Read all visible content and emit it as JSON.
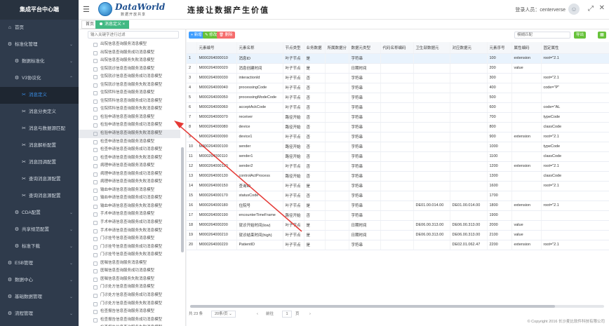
{
  "sidebar": {
    "title": "集成平台中心端",
    "items": [
      {
        "label": "首页",
        "icon": "home-icon",
        "glyph": "⌂",
        "level": 1,
        "chevron": ""
      },
      {
        "label": "标准化管理",
        "icon": "settings-icon",
        "glyph": "⚙",
        "level": 1,
        "chevron": "⌄"
      },
      {
        "label": "数据标准化",
        "icon": "settings-icon",
        "glyph": "⚙",
        "level": 2,
        "chevron": "⌄"
      },
      {
        "label": "V3协议化",
        "icon": "settings-icon",
        "glyph": "⚙",
        "level": 2,
        "chevron": "⌃"
      },
      {
        "label": "消息定义",
        "icon": "tool-icon",
        "glyph": "✂",
        "level": 3,
        "chevron": "",
        "active": true
      },
      {
        "label": "消息分类定义",
        "icon": "tool-icon",
        "glyph": "✂",
        "level": 3,
        "chevron": ""
      },
      {
        "label": "消息与数据源匹配",
        "icon": "tool-icon",
        "glyph": "✂",
        "level": 3,
        "chevron": ""
      },
      {
        "label": "消息解析配置",
        "icon": "tool-icon",
        "glyph": "✂",
        "level": 3,
        "chevron": ""
      },
      {
        "label": "消息回调配置",
        "icon": "tool-icon",
        "glyph": "✂",
        "level": 3,
        "chevron": ""
      },
      {
        "label": "查询消息源配置",
        "icon": "tool-icon",
        "glyph": "✂",
        "level": 3,
        "chevron": ""
      },
      {
        "label": "查询消息源配置",
        "icon": "tool-icon",
        "glyph": "✂",
        "level": 3,
        "chevron": ""
      },
      {
        "label": "CDA配置",
        "icon": "settings-icon",
        "glyph": "⚙",
        "level": 2,
        "chevron": "⌄"
      },
      {
        "label": "共享规范配置",
        "icon": "settings-icon",
        "glyph": "⚙",
        "level": 2,
        "chevron": "⌄"
      },
      {
        "label": "标准下载",
        "icon": "settings-icon",
        "glyph": "⚙",
        "level": 2,
        "chevron": "⌄"
      },
      {
        "label": "ESB管理",
        "icon": "settings-icon",
        "glyph": "⚙",
        "level": 1,
        "chevron": "⌄"
      },
      {
        "label": "数据中心",
        "icon": "settings-icon",
        "glyph": "⚙",
        "level": 1,
        "chevron": "⌄"
      },
      {
        "label": "基础数据管理",
        "icon": "settings-icon",
        "glyph": "⚙",
        "level": 1,
        "chevron": "⌄"
      },
      {
        "label": "流程管理",
        "icon": "settings-icon",
        "glyph": "⚙",
        "level": 1,
        "chevron": "⌄"
      },
      {
        "label": "统计管理",
        "icon": "settings-icon",
        "glyph": "⚙",
        "level": 1,
        "chevron": "⌄"
      }
    ]
  },
  "header": {
    "logo_text": "DataWorld",
    "logo_sub": "数据开放共享",
    "slogan": "连接让数据产生价值",
    "login_prefix": "登录人员：",
    "user": "centerverse"
  },
  "tabs": {
    "home": "首页",
    "current": "消息定义"
  },
  "tree": {
    "search_placeholder": "输入关键字进行过滤",
    "items": [
      "出院信息查询服务消息模型",
      "出院信息查询服务成功消息模型",
      "出院信息查询服务失败消息模型",
      "住院就诊信息查询服务消息模型",
      "住院就诊信息查询服务成功消息模型",
      "住院就诊信息查询服务失败消息模型",
      "住院转科信息查询服务消息模型",
      "住院转科信息查询服务成功消息模型",
      "住院转科信息查询服务失败消息模型",
      "检验申请信息查询服务消息模型",
      "检验申请信息查询服务成功消息模型",
      "检验申请信息查询服务失败消息模型",
      "检查申请信息查询服务消息模型",
      "检查申请信息查询服务成功消息模型",
      "检查申请信息查询服务失败消息模型",
      "病理申请信息查询服务消息模型",
      "病理申请信息查询服务成功消息模型",
      "病理申请信息查询服务失败消息模型",
      "输血申请信息查询服务消息模型",
      "输血申请信息查询服务成功消息模型",
      "输血申请信息查询服务失败消息模型",
      "手术申请信息查询服务消息模型",
      "手术申请信息查询服务成功消息模型",
      "手术申请信息查询服务失败消息模型",
      "门诊挂号信息查询服务消息模型",
      "门诊挂号信息查询服务成功消息模型",
      "门诊挂号信息查询服务失败消息模型",
      "医嘱信息查询服务消息模型",
      "医嘱信息查询服务成功消息模型",
      "医嘱信息查询服务失败消息模型",
      "门诊处方信息查询服务消息模型",
      "门诊处方信息查询服务成功消息模型",
      "门诊处方信息查询服务失败消息模型",
      "检查报告信息查询服务消息模型",
      "检查报告信息查询服务成功消息模型",
      "检查报告信息查询服务失败消息模型"
    ],
    "selected_index": 11
  },
  "toolbar": {
    "add": "+ 新增",
    "edit": "✎ 修改",
    "delete": "🗑 删除",
    "search_placeholder": "模糊匹配",
    "export": "导出",
    "grid_glyph": "▦"
  },
  "table": {
    "headers": [
      "",
      "元素编号",
      "元素名称",
      "节点类型",
      "业务数据",
      "所属数据分",
      "数据元类型",
      "代码名称编码",
      "卫生部数据元",
      "对应数据元",
      "元素序号",
      "属性编码",
      "固定属性"
    ],
    "rows": [
      [
        "1",
        "M000264000010",
        "消息ID",
        "叶子节点",
        "是",
        "",
        "字符串",
        "",
        "",
        "",
        "100",
        "extension",
        "root=\"2.1"
      ],
      [
        "2",
        "M000264000020",
        "消息创建时间",
        "叶子节点",
        "是",
        "",
        "日期时间",
        "",
        "",
        "",
        "200",
        "value",
        ""
      ],
      [
        "3",
        "M000264000030",
        "interactionId",
        "叶子节点",
        "否",
        "",
        "字符串",
        "",
        "",
        "",
        "300",
        "",
        "root=\"2.1"
      ],
      [
        "4",
        "M000264000040",
        "processingCode",
        "叶子节点",
        "否",
        "",
        "字符串",
        "",
        "",
        "",
        "400",
        "",
        "code=\"P\""
      ],
      [
        "5",
        "M000264000050",
        "processingModeCode",
        "叶子节点",
        "否",
        "",
        "字符串",
        "",
        "",
        "",
        "500",
        "",
        ""
      ],
      [
        "6",
        "M000264000060",
        "acceptAckCode",
        "叶子节点",
        "否",
        "",
        "字符串",
        "",
        "",
        "",
        "600",
        "",
        "code=\"AL"
      ],
      [
        "7",
        "M000264000070",
        "receiver",
        "路径开始",
        "否",
        "",
        "字符串",
        "",
        "",
        "",
        "700",
        "",
        "typeCode"
      ],
      [
        "8",
        "M000264000080",
        "device",
        "路径开始",
        "否",
        "",
        "字符串",
        "",
        "",
        "",
        "800",
        "",
        "classCode"
      ],
      [
        "9",
        "M000264000090",
        "device1",
        "叶子节点",
        "否",
        "",
        "字符串",
        "",
        "",
        "",
        "900",
        "extension",
        "root=\"2.1"
      ],
      [
        "10",
        "M000264000100",
        "sender",
        "路径开始",
        "否",
        "",
        "字符串",
        "",
        "",
        "",
        "1000",
        "",
        "typeCode"
      ],
      [
        "11",
        "M000264000110",
        "sender1",
        "路径开始",
        "否",
        "",
        "字符串",
        "",
        "",
        "",
        "1100",
        "",
        "classCode"
      ],
      [
        "12",
        "M000264000120",
        "sender2",
        "叶子节点",
        "否",
        "",
        "字符串",
        "",
        "",
        "",
        "1200",
        "extension",
        "root=\"2.1"
      ],
      [
        "13",
        "M000264000130",
        "controlActProcess",
        "路径开始",
        "否",
        "",
        "字符串",
        "",
        "",
        "",
        "1300",
        "",
        "classCode"
      ],
      [
        "14",
        "M000264000150",
        "查询ID",
        "叶子节点",
        "是",
        "",
        "字符串",
        "",
        "",
        "",
        "1600",
        "",
        "root=\"2.1"
      ],
      [
        "15",
        "M000264000170",
        "statusCode",
        "叶子节点",
        "否",
        "",
        "字符串",
        "",
        "",
        "",
        "1700",
        "",
        ""
      ],
      [
        "16",
        "M000264000180",
        "住院号",
        "叶子节点",
        "是",
        "",
        "字符串",
        "",
        "DE01.00.014.00",
        "DE01.00.014.00",
        "1800",
        "extension",
        "root=\"2.1"
      ],
      [
        "17",
        "M000264000190",
        "encounterTimeFrame",
        "路径开始",
        "否",
        "",
        "字符串",
        "",
        "",
        "",
        "1900",
        "",
        ""
      ],
      [
        "18",
        "M000264000200",
        "就诊开始时间(low)",
        "叶子节点",
        "是",
        "",
        "日期时间",
        "",
        "DE06.00.313.00",
        "DE06.00.313.00",
        "2000",
        "value",
        ""
      ],
      [
        "19",
        "M000264000210",
        "就诊结束时间(high)",
        "叶子节点",
        "是",
        "",
        "日期时间",
        "",
        "DE06.00.313.00",
        "DE06.00.313.00",
        "2100",
        "value",
        ""
      ],
      [
        "20",
        "M000264000220",
        "PatientID",
        "叶子节点",
        "是",
        "",
        "字符串",
        "",
        "",
        "DE02.01.062.47",
        "2200",
        "extension",
        "root=\"2.1"
      ]
    ],
    "highlight_row": 0
  },
  "pagination": {
    "total": "共 23 条",
    "page_size": "20条/页",
    "prev": "‹",
    "goto_label": "前往",
    "page": "1",
    "page_suffix": "页",
    "next": "›"
  },
  "footer": {
    "copyright": "© Copyright 2016 长沙麦比软件科技有限公司"
  },
  "annotation": {
    "color": "#e53935"
  }
}
